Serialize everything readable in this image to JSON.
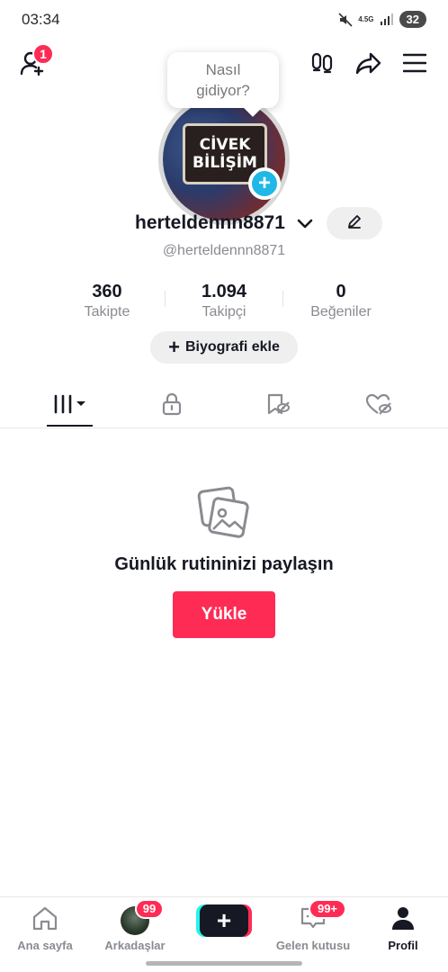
{
  "status_bar": {
    "time": "03:34",
    "network": "4.5G",
    "battery": "32",
    "icons": [
      "mute-icon",
      "signal-icon"
    ]
  },
  "top_actions": {
    "add_friends_badge": "1",
    "icons": [
      "add-friend-icon",
      "footprints-icon",
      "share-icon",
      "menu-icon"
    ]
  },
  "tooltip": {
    "line1": "Nasıl",
    "line2": "gidiyor?"
  },
  "avatar": {
    "sign_line1": "CİVEK",
    "sign_line2": "BİLİŞİM",
    "add_symbol": "+"
  },
  "profile": {
    "username": "herteldennn8871",
    "handle": "@herteldennn8871"
  },
  "stats": [
    {
      "value": "360",
      "label": "Takipte"
    },
    {
      "value": "1.094",
      "label": "Takipçi"
    },
    {
      "value": "0",
      "label": "Beğeniler"
    }
  ],
  "bio_button": {
    "plus": "+",
    "label": "Biyografi ekle"
  },
  "tabs": [
    "videos-grid-icon",
    "lock-icon",
    "favorites-icon",
    "liked-icon"
  ],
  "empty_state": {
    "title": "Günlük rutininizi paylaşın",
    "button": "Yükle",
    "icon": "photo-stack-icon"
  },
  "bottom_nav": {
    "home": "Ana sayfa",
    "friends": "Arkadaşlar",
    "friends_badge": "99",
    "create": "+",
    "inbox": "Gelen kutusu",
    "inbox_badge": "99+",
    "profile": "Profil"
  },
  "colors": {
    "accent": "#fe2c55",
    "cyan": "#25f4ee",
    "avatar_plus": "#20b8e6",
    "text_primary": "#161823",
    "text_secondary": "#8a8b91"
  }
}
